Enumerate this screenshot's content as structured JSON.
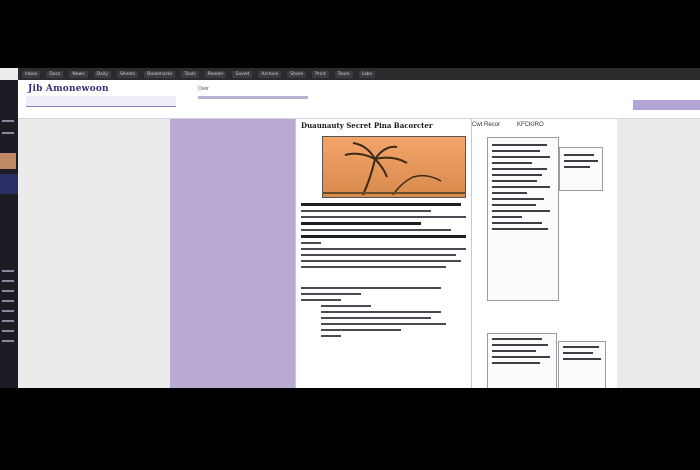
{
  "tabs": [
    "Inbox",
    "Docs",
    "News",
    "Daily",
    "Sheets",
    "Bookmarks",
    "Tools",
    "Reader",
    "Saved",
    "Archive",
    "Share",
    "Print",
    "Team",
    "Labs"
  ],
  "header": {
    "brand": "Jib Amonewoon",
    "mid_text": "Over"
  },
  "article": {
    "title": "Duaunauty Secret Pina Bacorcter"
  },
  "side_panel": {
    "label_left": "Cwt Recor",
    "label_right": "KFCKIRO"
  },
  "colors": {
    "accent_purple": "#b9a9d3",
    "brand": "#3c2f78",
    "hero_orange": "#f2a46a"
  }
}
